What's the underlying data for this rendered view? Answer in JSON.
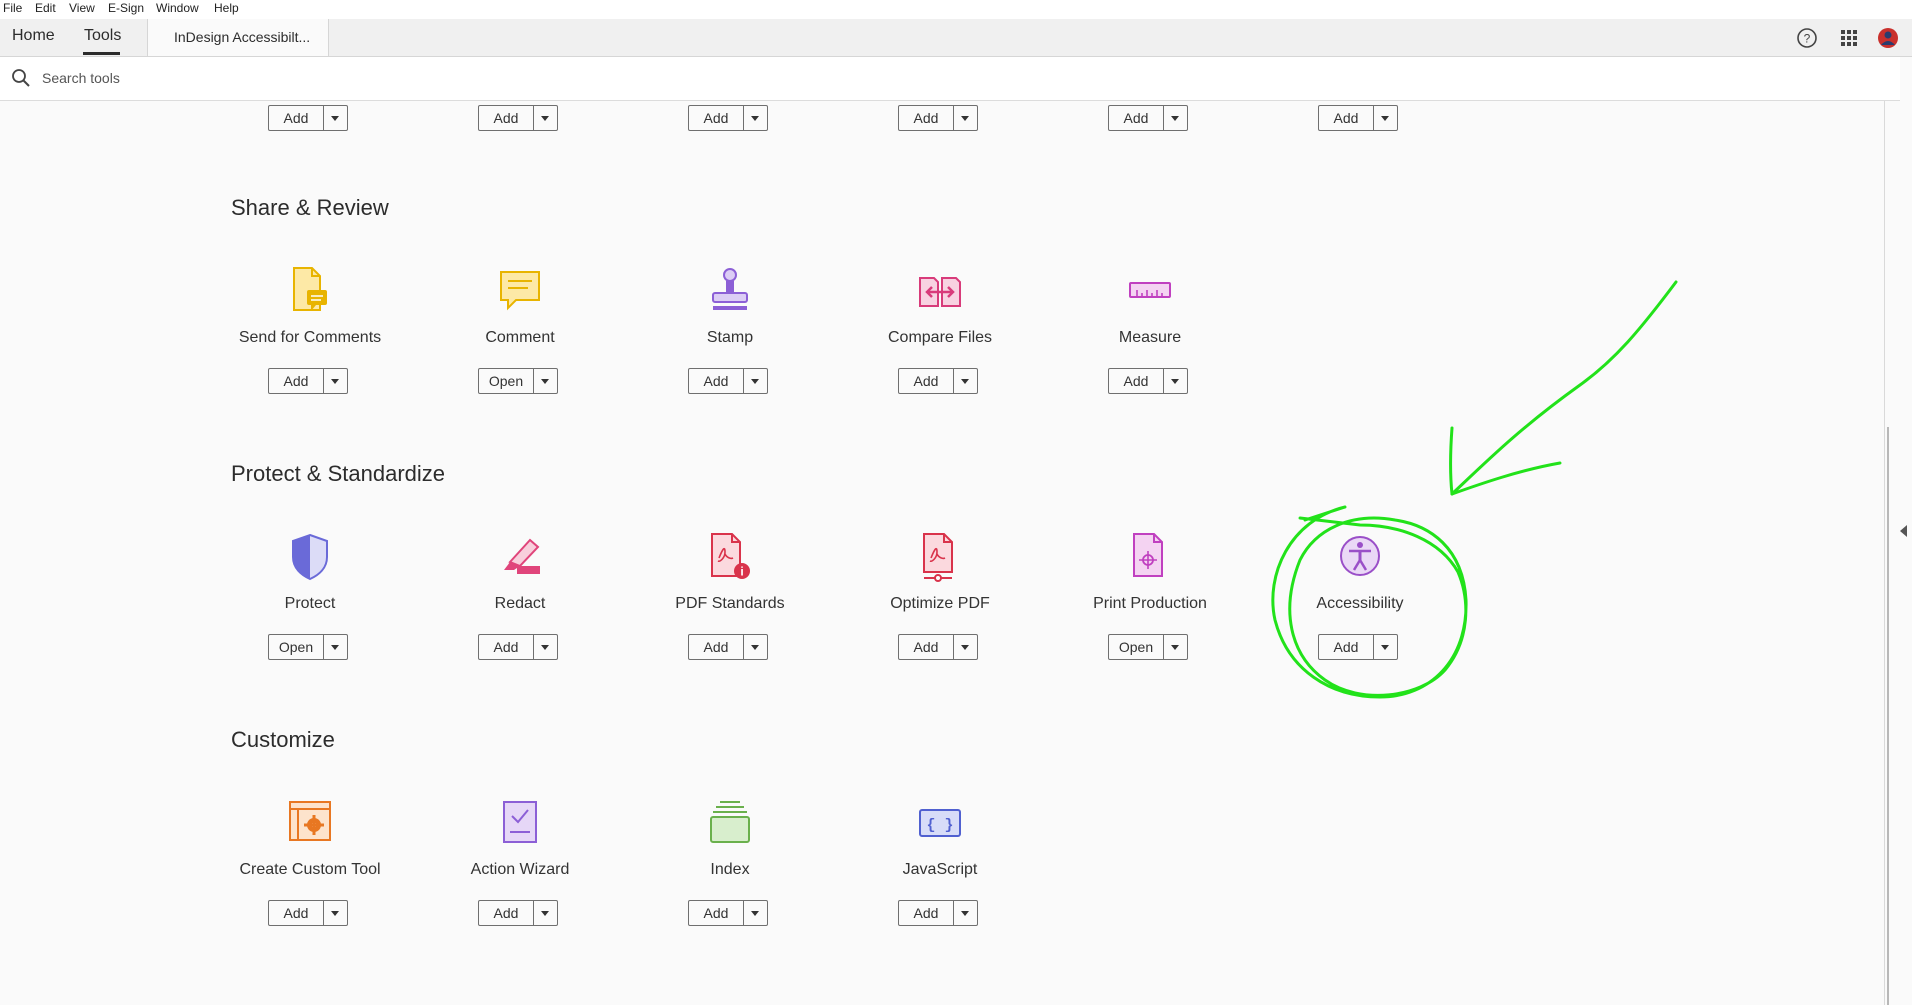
{
  "menubar": [
    "File",
    "Edit",
    "View",
    "E-Sign",
    "Window",
    "Help"
  ],
  "tabs": {
    "home": "Home",
    "tools": "Tools",
    "document": "InDesign Accessibilt..."
  },
  "search": {
    "placeholder": "Search tools"
  },
  "top_row_buttons": [
    "Add",
    "Add",
    "Add",
    "Add",
    "Add",
    "Add"
  ],
  "sections": [
    {
      "title": "Share & Review",
      "tools": [
        {
          "label": "Send for Comments",
          "button": "Add",
          "icon": "send-for-comments-icon"
        },
        {
          "label": "Comment",
          "button": "Open",
          "icon": "comment-icon"
        },
        {
          "label": "Stamp",
          "button": "Add",
          "icon": "stamp-icon"
        },
        {
          "label": "Compare Files",
          "button": "Add",
          "icon": "compare-files-icon"
        },
        {
          "label": "Measure",
          "button": "Add",
          "icon": "measure-icon"
        }
      ]
    },
    {
      "title": "Protect & Standardize",
      "tools": [
        {
          "label": "Protect",
          "button": "Open",
          "icon": "shield-icon"
        },
        {
          "label": "Redact",
          "button": "Add",
          "icon": "redact-icon"
        },
        {
          "label": "PDF Standards",
          "button": "Add",
          "icon": "pdf-standards-icon"
        },
        {
          "label": "Optimize PDF",
          "button": "Add",
          "icon": "optimize-pdf-icon"
        },
        {
          "label": "Print Production",
          "button": "Open",
          "icon": "print-production-icon"
        },
        {
          "label": "Accessibility",
          "button": "Add",
          "icon": "accessibility-icon"
        }
      ]
    },
    {
      "title": "Customize",
      "tools": [
        {
          "label": "Create Custom Tool",
          "button": "Add",
          "icon": "create-custom-tool-icon"
        },
        {
          "label": "Action Wizard",
          "button": "Add",
          "icon": "action-wizard-icon"
        },
        {
          "label": "Index",
          "button": "Add",
          "icon": "index-icon"
        },
        {
          "label": "JavaScript",
          "button": "Add",
          "icon": "javascript-icon"
        }
      ]
    }
  ],
  "annotation": {
    "color": "#22e21a",
    "target": "Accessibility"
  },
  "colors": {
    "share": "#e8b400",
    "stamp": "#8c5fd6",
    "compare": "#d83b7a",
    "measure": "#c040c0",
    "protect": "#6a6ad8",
    "redact": "#e0457b",
    "pdf": "#d9334b",
    "accessibility": "#9a4fc8",
    "customize": "#e87722",
    "index": "#6ab04c",
    "javascript": "#5060d0"
  }
}
